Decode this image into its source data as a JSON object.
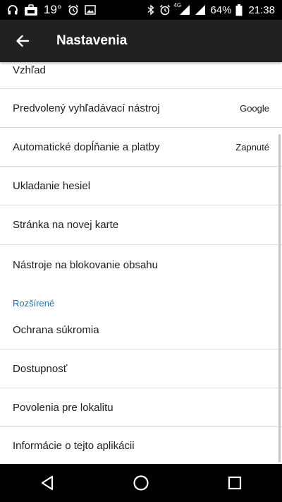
{
  "status_bar": {
    "temperature": "19°",
    "battery_percent": "64%",
    "network": "4G",
    "time": "21:38",
    "icons": [
      "headphones-icon",
      "briefcase-icon",
      "alarm-icon",
      "image-icon",
      "bluetooth-icon",
      "alarm-icon",
      "signal-icon",
      "battery-icon"
    ]
  },
  "app_bar": {
    "title": "Nastavenia",
    "back_icon": "arrow-back-icon"
  },
  "settings": {
    "items": [
      {
        "label": "Vzhľad",
        "value": ""
      },
      {
        "label": "Predvolený vyhľadávací nástroj",
        "value": "Google"
      },
      {
        "label": "Automatické dopĺňanie a platby",
        "value": "Zapnuté"
      },
      {
        "label": "Ukladanie hesiel",
        "value": ""
      },
      {
        "label": "Stránka na novej karte",
        "value": ""
      },
      {
        "label": "Nástroje na blokovanie obsahu",
        "value": ""
      }
    ],
    "section_advanced": "Rozšírené",
    "advanced_items": [
      {
        "label": "Ochrana súkromia"
      },
      {
        "label": "Dostupnosť"
      },
      {
        "label": "Povolenia pre lokalitu"
      },
      {
        "label": "Informácie o tejto aplikácii"
      }
    ]
  },
  "colors": {
    "app_bar": "#212121",
    "section_header": "#1a73a8",
    "divider": "#dcdcdc"
  },
  "nav_bar": {
    "icons": [
      "back-triangle-icon",
      "home-circle-icon",
      "recents-square-icon"
    ]
  }
}
